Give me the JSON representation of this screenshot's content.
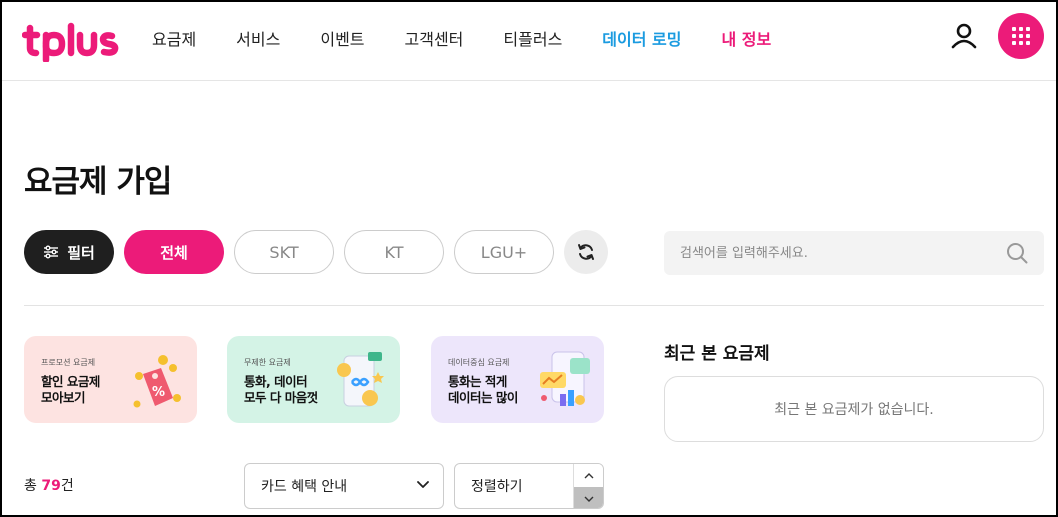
{
  "header": {
    "logo_text": "tplus",
    "nav": [
      {
        "label": "요금제"
      },
      {
        "label": "서비스"
      },
      {
        "label": "이벤트"
      },
      {
        "label": "고객센터"
      },
      {
        "label": "티플러스"
      },
      {
        "label": "데이터 로밍"
      },
      {
        "label": "내 정보"
      }
    ],
    "user_icon": "user-icon",
    "menu_icon": "grid-icon"
  },
  "page": {
    "title": "요금제 가입"
  },
  "filters": {
    "filter_label": "필터",
    "filter_icon": "sliders-icon",
    "options": [
      {
        "label": "전체",
        "selected": true
      },
      {
        "label": "SKT",
        "selected": false
      },
      {
        "label": "KT",
        "selected": false
      },
      {
        "label": "LGU+",
        "selected": false
      }
    ],
    "refresh_icon": "refresh-icon"
  },
  "search": {
    "placeholder": "검색어를 입력해주세요.",
    "value": "",
    "icon": "search-icon"
  },
  "banners": [
    {
      "sub": "프로모션 요금제",
      "line1": "할인 요금제",
      "line2": "모아보기",
      "icon": "discount-tag-icon"
    },
    {
      "sub": "무제한 요금제",
      "line1": "통화, 데이터",
      "line2": "모두 다 마음껏",
      "icon": "unlimited-phone-icon"
    },
    {
      "sub": "데이터중심 요금제",
      "line1": "통화는 적게",
      "line2": "데이터는 많이",
      "icon": "data-chart-icon"
    }
  ],
  "recent": {
    "title": "최근 본 요금제",
    "empty_message": "최근 본 요금제가 없습니다."
  },
  "list": {
    "total_prefix": "총 ",
    "total_count": "79",
    "total_suffix": "건",
    "card_select": "카드 혜택 안내",
    "sort_select": "정렬하기"
  },
  "colors": {
    "brand_pink": "#ec1b79",
    "roaming_blue": "#1b9be0",
    "dark": "#1f1f1f"
  }
}
